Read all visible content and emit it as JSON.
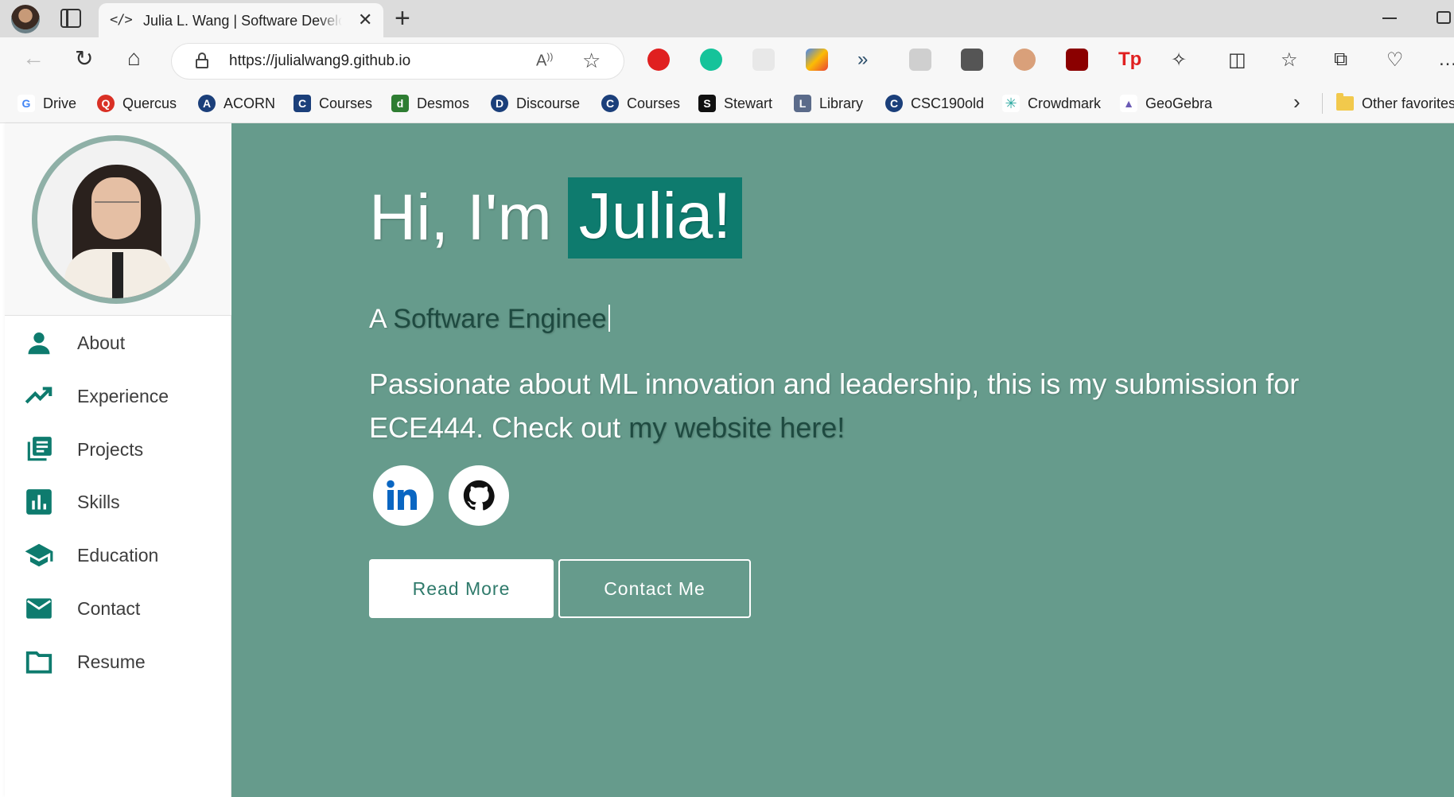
{
  "browser": {
    "tab_title": "Julia L. Wang | Software Developer",
    "tab_icon": "</>",
    "url": "https://julialwang9.github.io"
  },
  "bookmarks": [
    {
      "label": "Drive",
      "icon": "G",
      "color": "#4285f4"
    },
    {
      "label": "Quercus",
      "icon": "Q",
      "color": "#d93025"
    },
    {
      "label": "ACORN",
      "icon": "A",
      "color": "#1b3f7a"
    },
    {
      "label": "Courses",
      "icon": "C",
      "color": "#1b3f7a"
    },
    {
      "label": "Desmos",
      "icon": "d",
      "color": "#2e7d32"
    },
    {
      "label": "Discourse",
      "icon": "D",
      "color": "#1b3f7a"
    },
    {
      "label": "Courses",
      "icon": "C",
      "color": "#1b3f7a"
    },
    {
      "label": "Stewart",
      "icon": "S",
      "color": "#111111"
    },
    {
      "label": "Library",
      "icon": "L",
      "color": "#5b6b8a"
    },
    {
      "label": "CSC190old",
      "icon": "C",
      "color": "#1b3f7a"
    },
    {
      "label": "Crowdmark",
      "icon": "✳",
      "color": "#2aa8a0"
    },
    {
      "label": "GeoGebra",
      "icon": "▲",
      "color": "#6b5bb5"
    }
  ],
  "other_favorites": "Other favorites",
  "sidebar": {
    "items": [
      {
        "label": "About",
        "icon": "person-icon"
      },
      {
        "label": "Experience",
        "icon": "trending-up-icon"
      },
      {
        "label": "Projects",
        "icon": "library-books-icon"
      },
      {
        "label": "Skills",
        "icon": "bar-chart-icon"
      },
      {
        "label": "Education",
        "icon": "graduation-cap-icon"
      },
      {
        "label": "Contact",
        "icon": "mail-icon"
      },
      {
        "label": "Resume",
        "icon": "folder-icon"
      }
    ]
  },
  "hero": {
    "greeting": "Hi, I'm",
    "name": "Julia!",
    "role_prefix": "A",
    "role": "Software Enginee",
    "tagline_text": "Passionate about ML innovation and leadership, this is my submission for ECE444. Check out",
    "tagline_link": "my website here!",
    "read_more": "Read More",
    "contact_me": "Contact Me"
  },
  "colors": {
    "hero_bg": "#669b8c",
    "accent": "#0e7b6e",
    "icon": "#0e7b6e"
  }
}
